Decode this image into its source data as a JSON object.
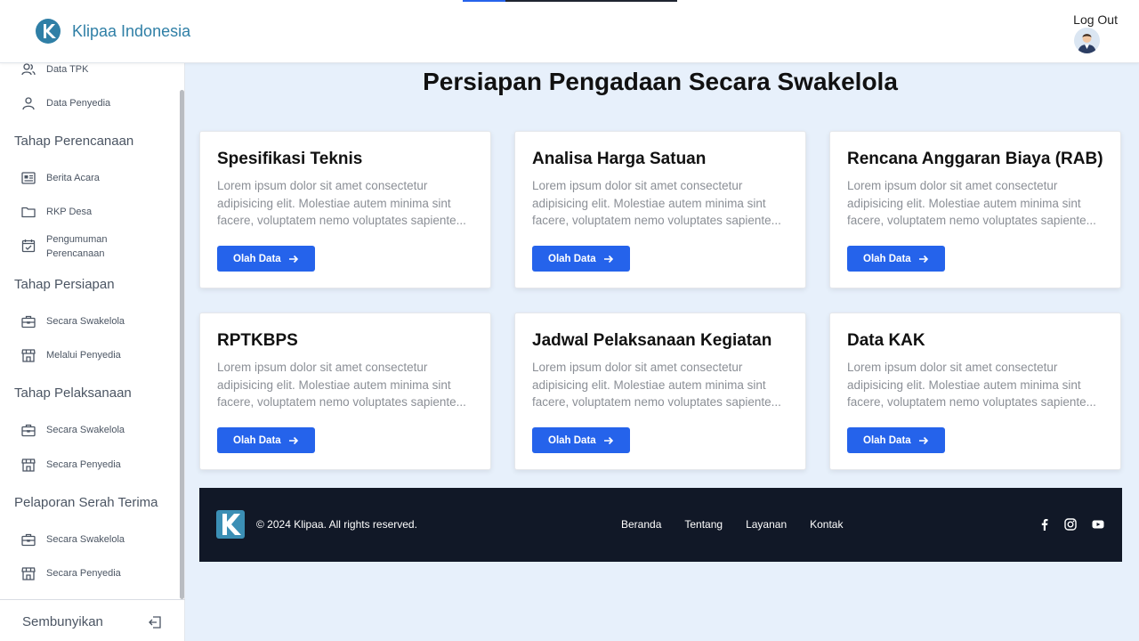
{
  "header": {
    "brand": "Klipaa Indonesia",
    "logout": "Log Out",
    "brand_color": "#2f7fa6"
  },
  "sidebar": {
    "items_top": [
      {
        "label": "Data TPK",
        "icon": "user-group-icon"
      },
      {
        "label": "Data Penyedia",
        "icon": "user-icon"
      }
    ],
    "sections": [
      {
        "title": "Tahap Perencanaan",
        "items": [
          {
            "label": "Berita Acara",
            "icon": "document-card-icon"
          },
          {
            "label": "RKP Desa",
            "icon": "folder-icon"
          },
          {
            "label": "Pengumuman Perencanaan",
            "icon": "calendar-check-icon"
          }
        ]
      },
      {
        "title": "Tahap Persiapan",
        "items": [
          {
            "label": "Secara Swakelola",
            "icon": "briefcase-icon"
          },
          {
            "label": "Melalui Penyedia",
            "icon": "store-icon"
          }
        ]
      },
      {
        "title": "Tahap Pelaksanaan",
        "items": [
          {
            "label": "Secara Swakelola",
            "icon": "briefcase-icon"
          },
          {
            "label": "Secara Penyedia",
            "icon": "store-icon"
          }
        ]
      },
      {
        "title": "Pelaporan Serah Terima",
        "items": [
          {
            "label": "Secara Swakelola",
            "icon": "briefcase-icon"
          },
          {
            "label": "Secara Penyedia",
            "icon": "store-icon"
          }
        ]
      }
    ],
    "hide_label": "Sembunyikan"
  },
  "main": {
    "title": "Persiapan Pengadaan Secara Swakelola",
    "cards": [
      {
        "title": "Spesifikasi Teknis",
        "description": "Lorem ipsum dolor sit amet consectetur adipisicing elit. Molestiae autem minima sint facere, voluptatem nemo voluptates sapiente...",
        "button": "Olah Data"
      },
      {
        "title": "Analisa Harga Satuan",
        "description": "Lorem ipsum dolor sit amet consectetur adipisicing elit. Molestiae autem minima sint facere, voluptatem nemo voluptates sapiente...",
        "button": "Olah Data"
      },
      {
        "title": "Rencana Anggaran Biaya (RAB)",
        "description": "Lorem ipsum dolor sit amet consectetur adipisicing elit. Molestiae autem minima sint facere, voluptatem nemo voluptates sapiente...",
        "button": "Olah Data"
      },
      {
        "title": "RPTKBPS",
        "description": "Lorem ipsum dolor sit amet consectetur adipisicing elit. Molestiae autem minima sint facere, voluptatem nemo voluptates sapiente...",
        "button": "Olah Data"
      },
      {
        "title": "Jadwal Pelaksanaan Kegiatan",
        "description": "Lorem ipsum dolor sit amet consectetur adipisicing elit. Molestiae autem minima sint facere, voluptatem nemo voluptates sapiente...",
        "button": "Olah Data"
      },
      {
        "title": "Data KAK",
        "description": "Lorem ipsum dolor sit amet consectetur adipisicing elit. Molestiae autem minima sint facere, voluptatem nemo voluptates sapiente...",
        "button": "Olah Data"
      }
    ],
    "button_color": "#2563eb"
  },
  "footer": {
    "copyright": "© 2024 Klipaa. All rights reserved.",
    "links": [
      "Beranda",
      "Tentang",
      "Layanan",
      "Kontak"
    ],
    "social": [
      "facebook-icon",
      "instagram-icon",
      "youtube-icon"
    ],
    "background": "#111827"
  }
}
